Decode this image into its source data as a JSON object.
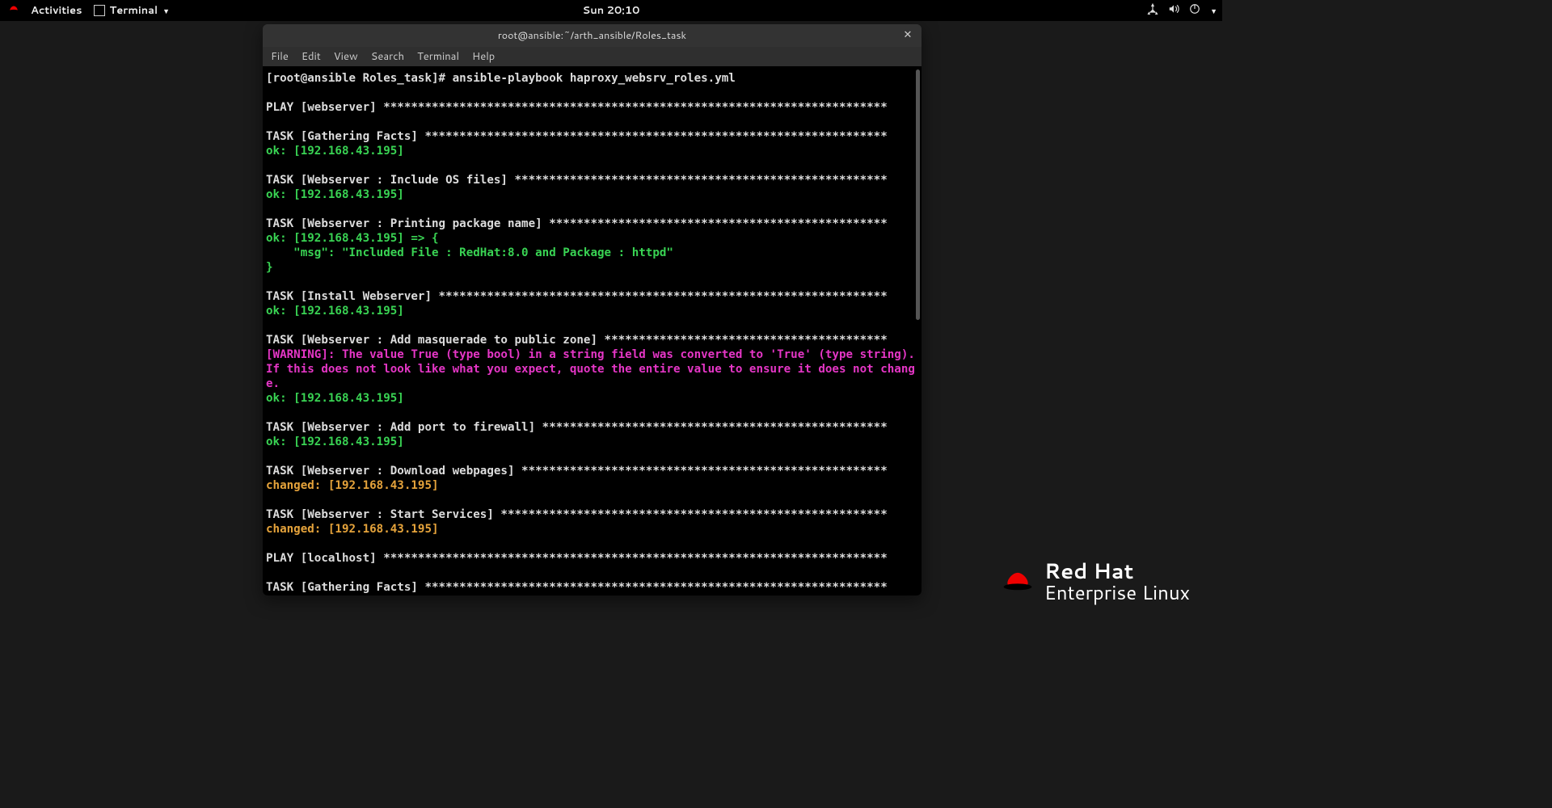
{
  "topbar": {
    "activities": "Activities",
    "app_label": "Terminal",
    "clock": "Sun 20:10"
  },
  "window": {
    "title": "root@ansible:~/arth_ansible/Roles_task"
  },
  "menu": {
    "file": "File",
    "edit": "Edit",
    "view": "View",
    "search": "Search",
    "terminal": "Terminal",
    "help": "Help"
  },
  "term": {
    "prompt": "[root@ansible Roles_task]# ansible-playbook haproxy_websrv_roles.yml",
    "play1": "PLAY [webserver] *************************************************************************",
    "t1_head": "TASK [Gathering Facts] *******************************************************************",
    "ok1": "ok: [192.168.43.195]",
    "t2_head": "TASK [Webserver : Include OS files] ******************************************************",
    "ok2": "ok: [192.168.43.195]",
    "t3_head": "TASK [Webserver : Printing package name] *************************************************",
    "t3_l1": "ok: [192.168.43.195] => {",
    "t3_l2": "    \"msg\": \"Included File : RedHat:8.0 and Package : httpd\"",
    "t3_l3": "}",
    "t4_head": "TASK [Install Webserver] *****************************************************************",
    "ok4": "ok: [192.168.43.195]",
    "t5_head": "TASK [Webserver : Add masquerade to public zone] *****************************************",
    "warn": "[WARNING]: The value True (type bool) in a string field was converted to 'True' (type string). If this does not look like what you expect, quote the entire value to ensure it does not change.",
    "ok5": "ok: [192.168.43.195]",
    "t6_head": "TASK [Webserver : Add port to firewall] **************************************************",
    "ok6": "ok: [192.168.43.195]",
    "t7_head": "TASK [Webserver : Download webpages] *****************************************************",
    "chg7": "changed: [192.168.43.195]",
    "t8_head": "TASK [Webserver : Start Services] ********************************************************",
    "chg8": "changed: [192.168.43.195]",
    "play2": "PLAY [localhost] *************************************************************************",
    "t9_head": "TASK [Gathering Facts] *******************************************************************"
  },
  "brand": {
    "l1": "Red Hat",
    "l2": "Enterprise Linux"
  }
}
